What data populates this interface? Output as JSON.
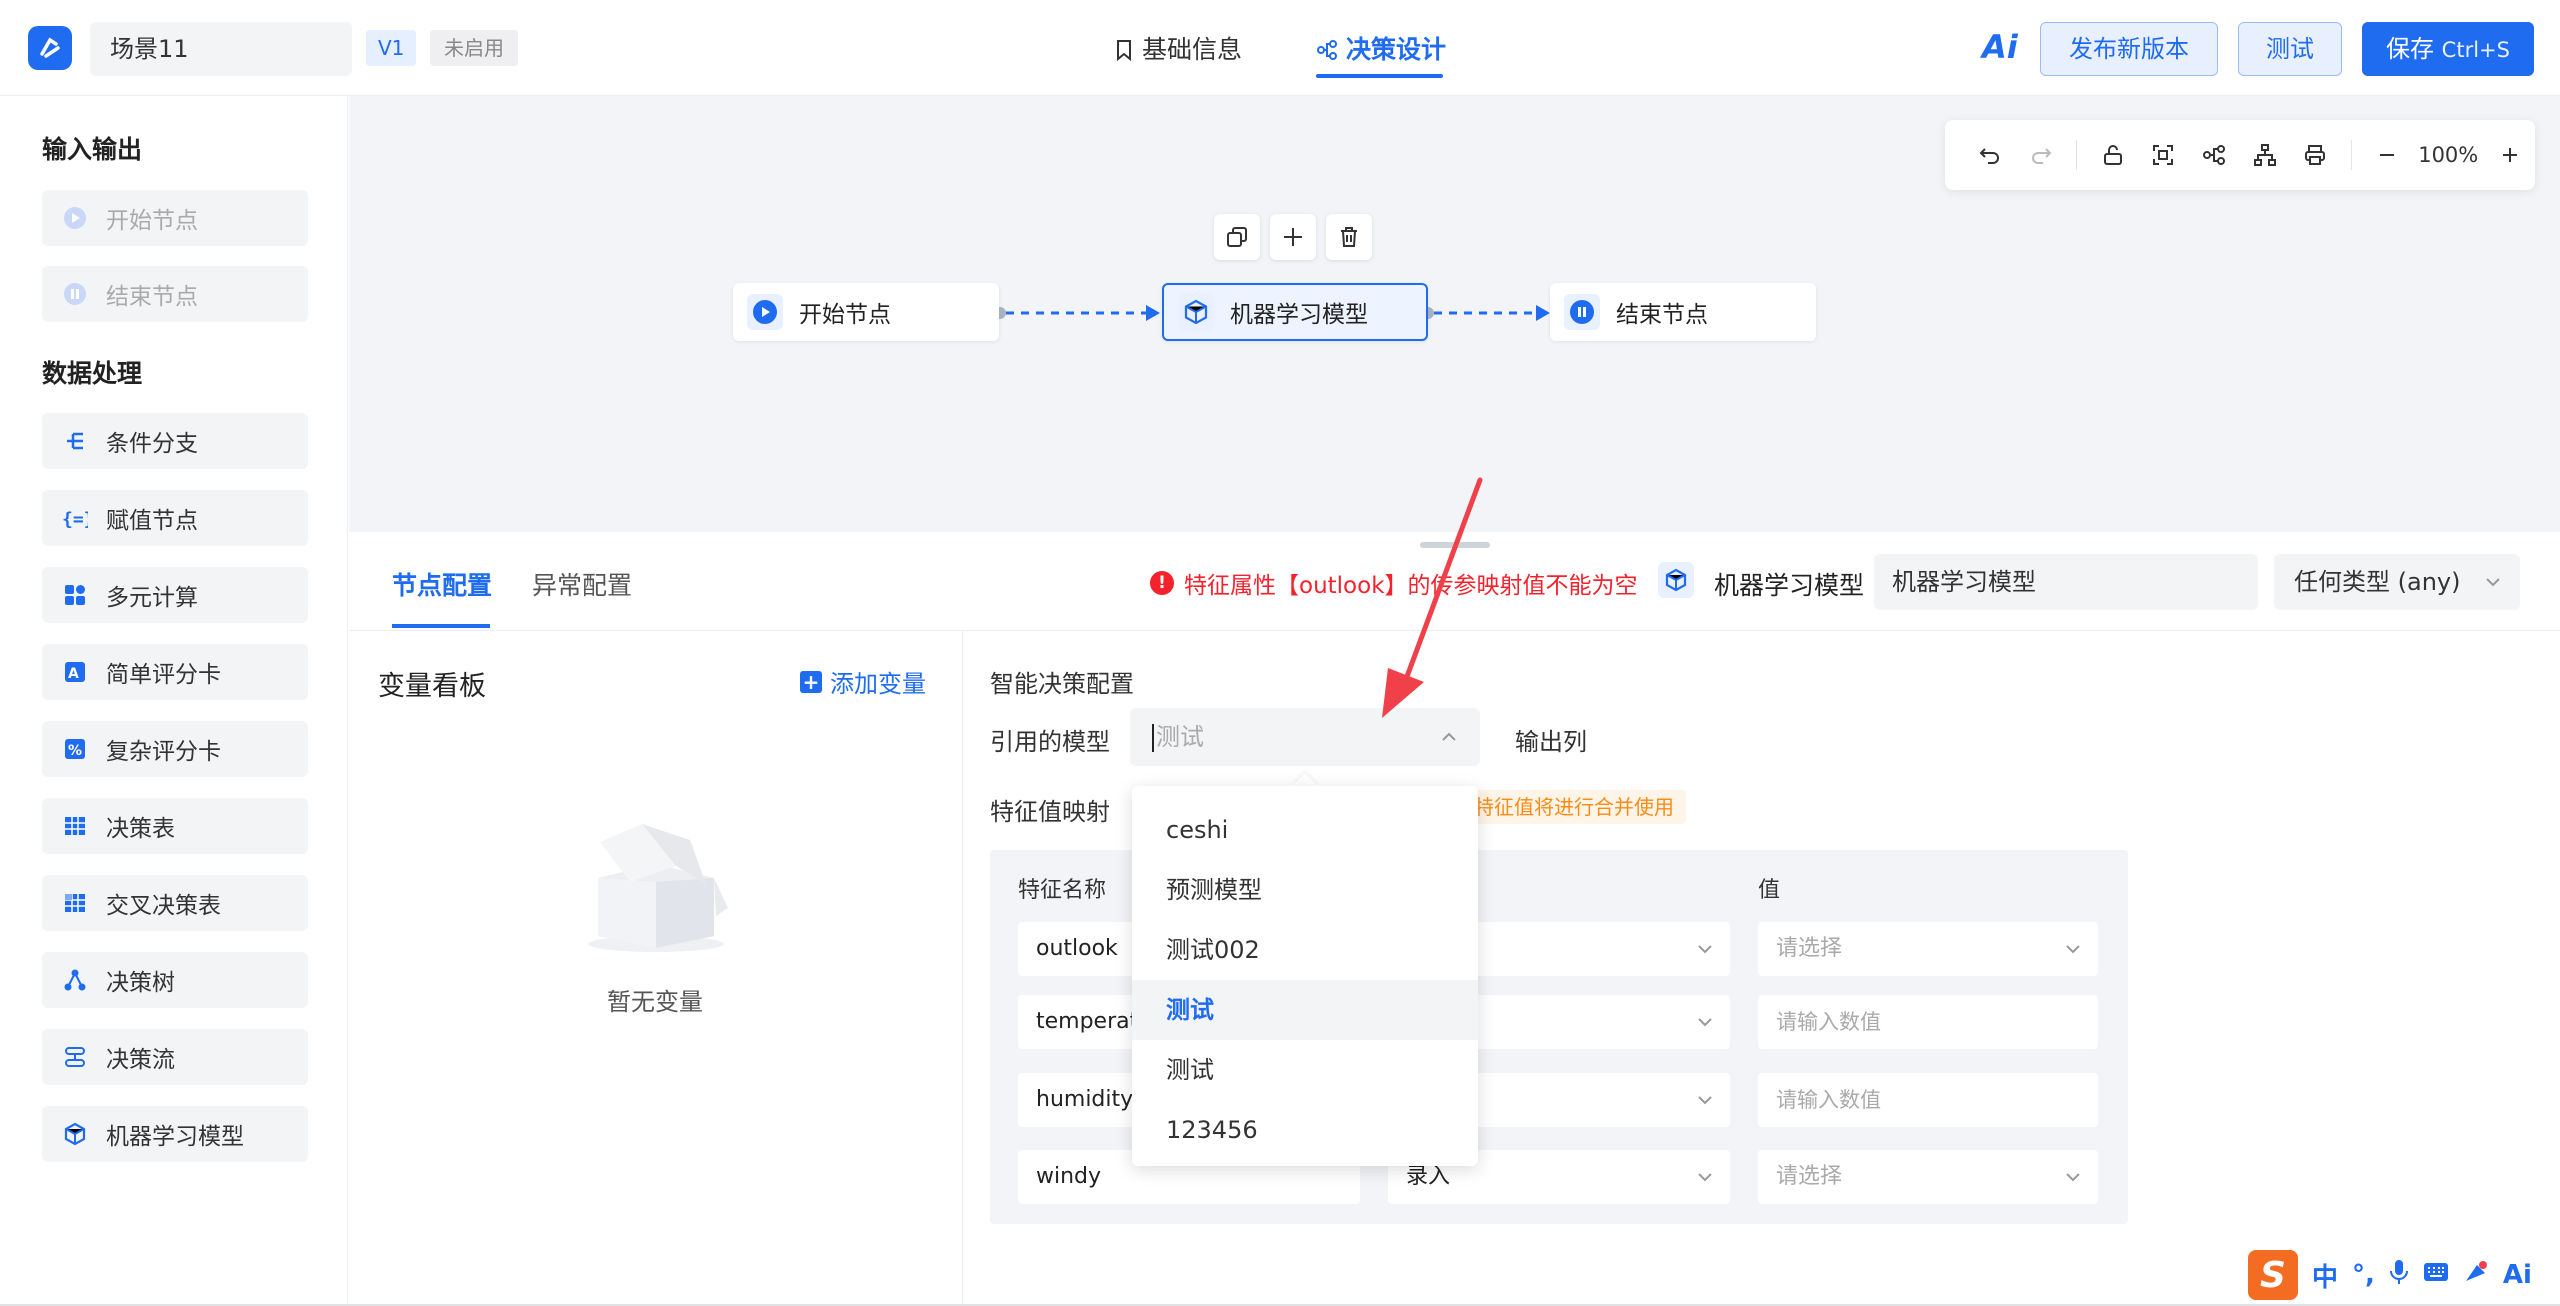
{
  "header": {
    "scene_name": "场景11",
    "version": "V1",
    "status": "未启用",
    "tabs": [
      {
        "label": "基础信息",
        "icon": "bookmark-icon"
      },
      {
        "label": "决策设计",
        "icon": "flow-icon",
        "active": true
      }
    ],
    "ai_label": "Ai",
    "publish_label": "发布新版本",
    "test_label": "测试",
    "save_label": "保存",
    "save_shortcut": "Ctrl+S"
  },
  "sidebar": {
    "section_io": "输入输出",
    "io_items": [
      {
        "label": "开始节点",
        "icon": "play-icon"
      },
      {
        "label": "结束节点",
        "icon": "pause-icon"
      }
    ],
    "section_data": "数据处理",
    "data_items": [
      {
        "label": "条件分支",
        "icon": "branch-icon"
      },
      {
        "label": "赋值节点",
        "icon": "assign-icon"
      },
      {
        "label": "多元计算",
        "icon": "calc-icon"
      },
      {
        "label": "简单评分卡",
        "icon": "scorecard-icon"
      },
      {
        "label": "复杂评分卡",
        "icon": "complex-scorecard-icon"
      },
      {
        "label": "决策表",
        "icon": "table-icon"
      },
      {
        "label": "交叉决策表",
        "icon": "cross-table-icon"
      },
      {
        "label": "决策树",
        "icon": "tree-icon"
      },
      {
        "label": "决策流",
        "icon": "flow-icon"
      },
      {
        "label": "机器学习模型",
        "icon": "cube-icon"
      }
    ]
  },
  "canvas": {
    "zoom": "100%",
    "nodes": [
      {
        "label": "开始节点",
        "icon": "play-icon"
      },
      {
        "label": "机器学习模型",
        "icon": "cube-icon",
        "selected": true
      },
      {
        "label": "结束节点",
        "icon": "pause-icon"
      }
    ]
  },
  "panel": {
    "tabs": [
      "节点配置",
      "异常配置"
    ],
    "error": "特征属性【outlook】的传参映射值不能为空",
    "node_type_label": "机器学习模型",
    "node_name": "机器学习模型",
    "type_select": "任何类型 (any)",
    "var_board_title": "变量看板",
    "add_var_label": "添加变量",
    "empty_text": "暂无变量",
    "config_title": "智能决策配置",
    "model_label": "引用的模型",
    "model_value": "测试",
    "output_col_label": "输出列",
    "feature_map_label": "特征值映射",
    "merge_note": "特征值将进行合并使用",
    "table_headers": [
      "特征名称",
      "值"
    ],
    "rows": [
      {
        "name": "outlook",
        "mode": "",
        "value": "请选择",
        "value_is_select": true
      },
      {
        "name": "temperat",
        "mode": "",
        "value": "请输入数值",
        "value_is_select": false
      },
      {
        "name": "humidity",
        "mode": "",
        "value": "请输入数值",
        "value_is_select": false
      },
      {
        "name": "windy",
        "mode": "录入",
        "value": "请选择",
        "value_is_select": true
      }
    ],
    "dropdown_options": [
      "ceshi",
      "预测模型",
      "测试002",
      "测试",
      "测试",
      "123456"
    ],
    "dropdown_selected_index": 3
  },
  "ime": {
    "lang": "中",
    "punct": "°,",
    "ai": "Ai"
  },
  "colors": {
    "accent": "#1f6cf0",
    "error": "#f5222d",
    "warning": "#fa8c16"
  }
}
